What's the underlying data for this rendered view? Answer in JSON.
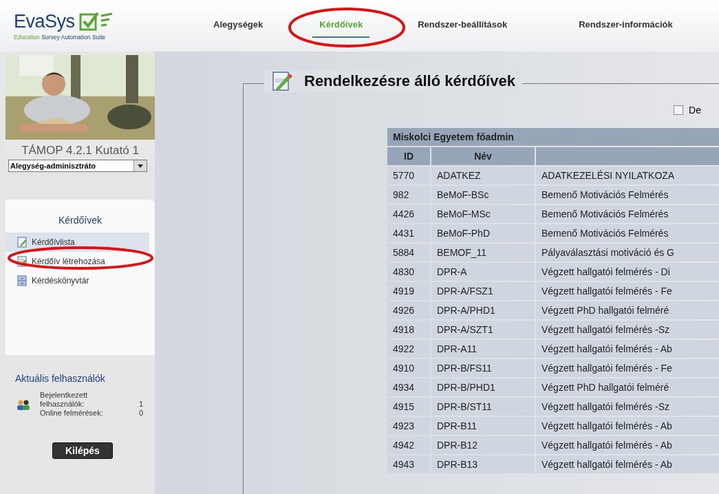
{
  "logo": {
    "name": "EvaSys",
    "tagline_highlight": "Education",
    "tagline_rest": "Survey Automation Suite"
  },
  "nav": [
    {
      "label": "Alegységek",
      "selected": false
    },
    {
      "label": "Kérdőívek",
      "selected": true
    },
    {
      "label": "Rendszer-beállítások",
      "selected": false
    },
    {
      "label": "Rendszer-információk",
      "selected": false
    }
  ],
  "profile": {
    "name": "TÁMOP 4.2.1 Kutató 1",
    "role": "Alegység-adminisztráto"
  },
  "menu": {
    "title": "Kérdőívek",
    "items": [
      {
        "label": "Kérdőívlista",
        "selected": true,
        "kind": "list"
      },
      {
        "label": "Kérdőív létrehozása",
        "selected": false,
        "kind": "create"
      },
      {
        "label": "Kérdéskönyvtár",
        "selected": false,
        "kind": "library"
      }
    ]
  },
  "users": {
    "title": "Aktuális felhasználók",
    "rows": [
      {
        "label": "Bejelentkezett felhasználók:",
        "value": "1"
      },
      {
        "label": "Online felmérések:",
        "value": "0"
      }
    ]
  },
  "logout": "Kilépés",
  "main": {
    "title": "Rendelkezésre álló kérdőívek",
    "checkbox": {
      "label": "De",
      "checked": false
    },
    "table": {
      "group": "Miskolci Egyetem főadmin",
      "columns": [
        "ID",
        "Név"
      ],
      "rows": [
        [
          "5770",
          "ADATKEZ",
          "ADATKEZELÉSI NYILATKOZA"
        ],
        [
          "982",
          "BeMoF-BSc",
          "Bemenő Motivációs Felmérés"
        ],
        [
          "4426",
          "BeMoF-MSc",
          "Bemenő Motivációs Felmérés"
        ],
        [
          "4431",
          "BeMoF-PhD",
          "Bemenő Motivációs Felmérés"
        ],
        [
          "5884",
          "BEMOF_11",
          "Pályaválasztási motiváció és G"
        ],
        [
          "4830",
          "DPR-A",
          "Végzett hallgatói felmérés - Di"
        ],
        [
          "4919",
          "DPR-A/FSZ1",
          "Végzett hallgatói felmérés - Fe"
        ],
        [
          "4926",
          "DPR-A/PHD1",
          "Végzett PhD hallgatói felméré"
        ],
        [
          "4918",
          "DPR-A/SZT1",
          "Végzett hallgatói felmérés -Sz"
        ],
        [
          "4922",
          "DPR-A11",
          "Végzett hallgatói felmérés - Ab"
        ],
        [
          "4910",
          "DPR-B/FS11",
          "Végzett hallgatói felmérés - Fe"
        ],
        [
          "4934",
          "DPR-B/PHD1",
          "Végzett PhD hallgatói felméré"
        ],
        [
          "4915",
          "DPR-B/ST11",
          "Végzett hallgatói felmérés -Sz"
        ],
        [
          "4923",
          "DPR-B11",
          "Végzett hallgatói felmérés - Ab"
        ],
        [
          "4942",
          "DPR-B12",
          "Végzett hallgatói felmérés - Ab"
        ],
        [
          "4943",
          "DPR-B13",
          "Végzett hallgatói felmérés - Ab"
        ]
      ]
    }
  }
}
